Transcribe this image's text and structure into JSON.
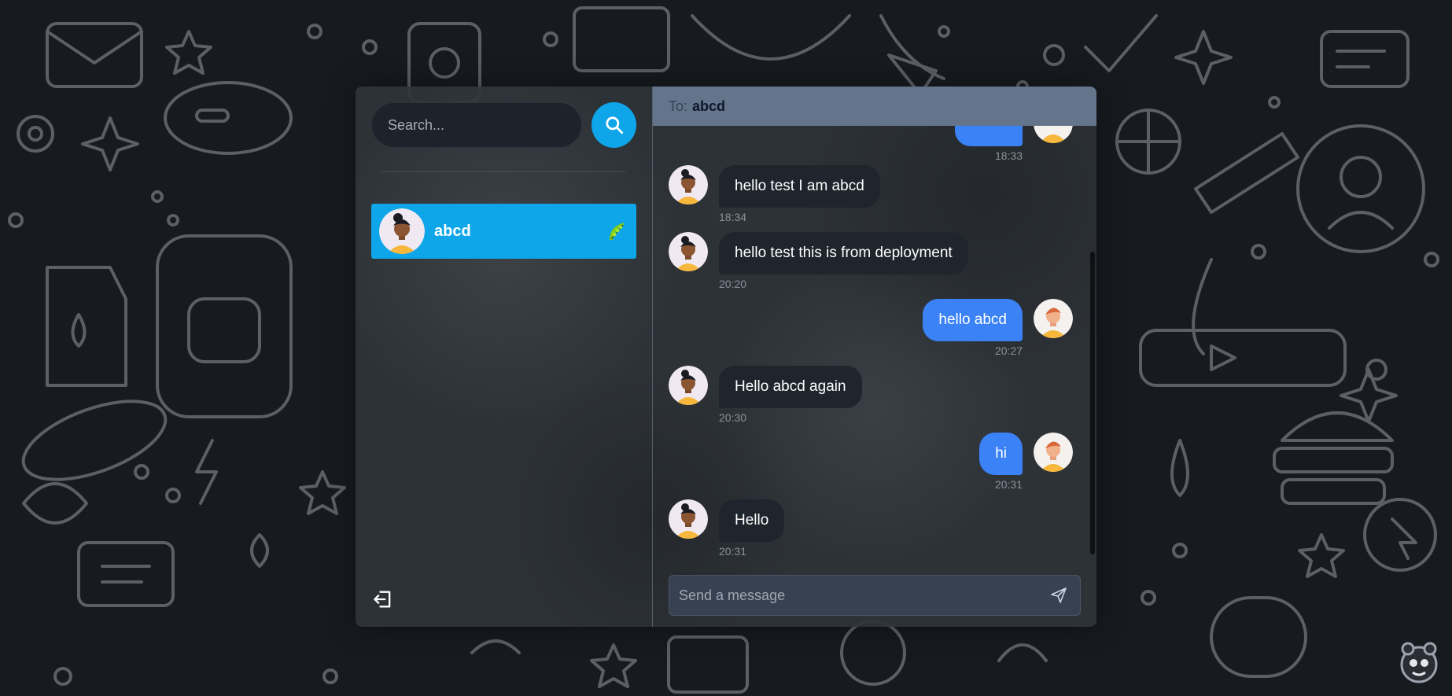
{
  "sidebar": {
    "search_placeholder": "Search...",
    "conversations": [
      {
        "name": "abcd",
        "emoji": "pea-pod-icon"
      }
    ]
  },
  "chat": {
    "to_label": "To:",
    "to_name": "abcd",
    "messages": [
      {
        "direction": "out",
        "text": "",
        "time": "18:33"
      },
      {
        "direction": "in",
        "text": "hello test I am abcd",
        "time": "18:34"
      },
      {
        "direction": "in",
        "text": "hello test this is from deployment",
        "time": "20:20"
      },
      {
        "direction": "out",
        "text": "hello abcd",
        "time": "20:27"
      },
      {
        "direction": "in",
        "text": "Hello abcd again",
        "time": "20:30"
      },
      {
        "direction": "out",
        "text": "hi",
        "time": "20:31"
      },
      {
        "direction": "in",
        "text": "Hello",
        "time": "20:31"
      }
    ],
    "composer_placeholder": "Send a message"
  },
  "colors": {
    "accent": "#0ea5e9",
    "outgoing_bubble": "#3b82f6",
    "incoming_bubble": "#1f252d",
    "header": "#64748b"
  }
}
